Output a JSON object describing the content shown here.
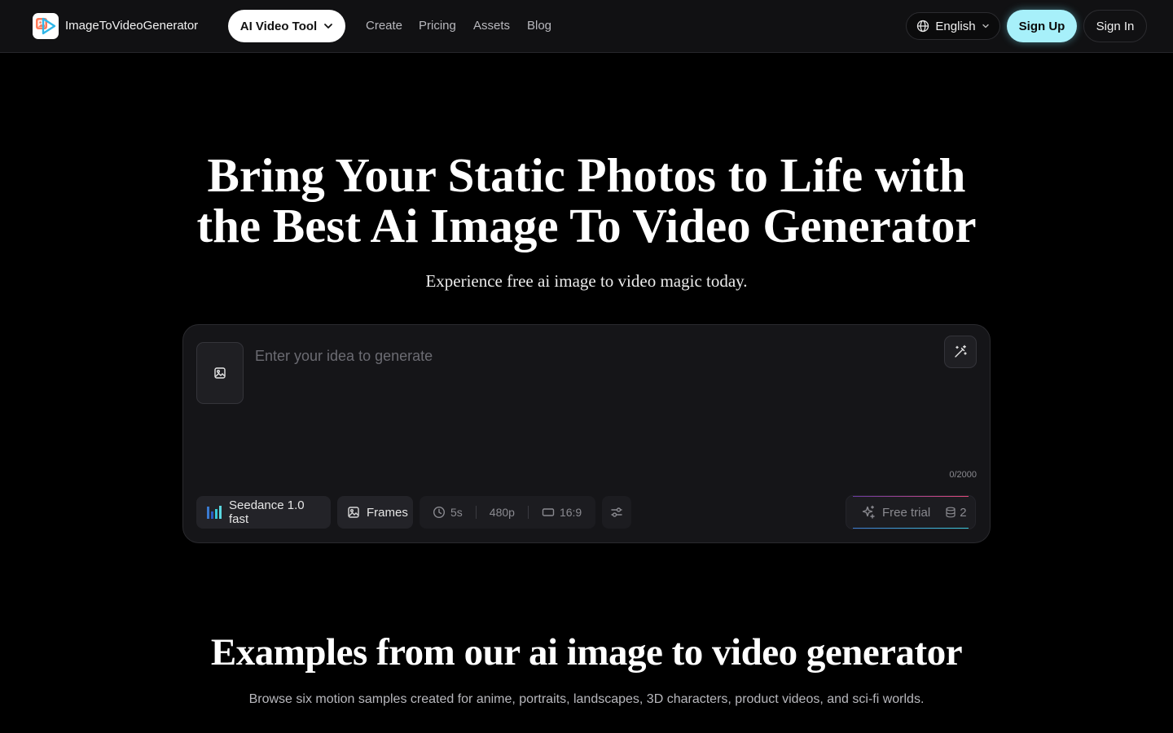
{
  "header": {
    "brand": "ImageToVideoGenerator",
    "tool_button": "AI Video Tool",
    "nav": [
      "Create",
      "Pricing",
      "Assets",
      "Blog"
    ],
    "language": "English",
    "sign_up": "Sign Up",
    "sign_in": "Sign In"
  },
  "hero": {
    "title_line1": "Bring Your Static Photos to Life with",
    "title_line2": "the Best Ai Image To Video Generator",
    "subtitle": "Experience free ai image to video magic today."
  },
  "generator": {
    "placeholder": "Enter your idea to generate",
    "counter": "0/2000",
    "model": "Seedance 1.0 fast",
    "frames": "Frames",
    "duration": "5s",
    "resolution": "480p",
    "aspect_ratio": "16:9",
    "trial_label": "Free trial",
    "credits": "2"
  },
  "examples": {
    "title": "Examples from our ai image to video generator",
    "subtitle": "Browse six motion samples created for anime, portraits, landscapes, 3D characters, product videos, and sci-fi worlds."
  },
  "colors": {
    "accent": "#a7f0fa",
    "background": "#000000",
    "card": "#151518"
  }
}
